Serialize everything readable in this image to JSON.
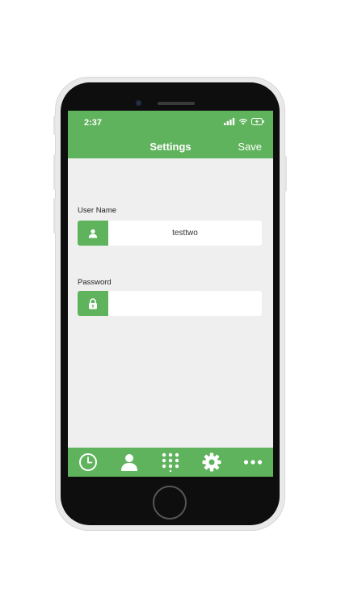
{
  "status_bar": {
    "time": "2:37"
  },
  "nav": {
    "title": "Settings",
    "save_label": "Save"
  },
  "form": {
    "username": {
      "label": "User Name",
      "value": "testtwo",
      "icon": "user-icon"
    },
    "password": {
      "label": "Password",
      "value": "",
      "icon": "lock-icon"
    }
  },
  "tabbar": {
    "items": [
      {
        "icon": "clock-icon"
      },
      {
        "icon": "person-icon"
      },
      {
        "icon": "keypad-icon"
      },
      {
        "icon": "gear-icon"
      },
      {
        "icon": "more-icon"
      }
    ]
  },
  "colors": {
    "accent": "#5fb35c",
    "background": "#efefef"
  }
}
